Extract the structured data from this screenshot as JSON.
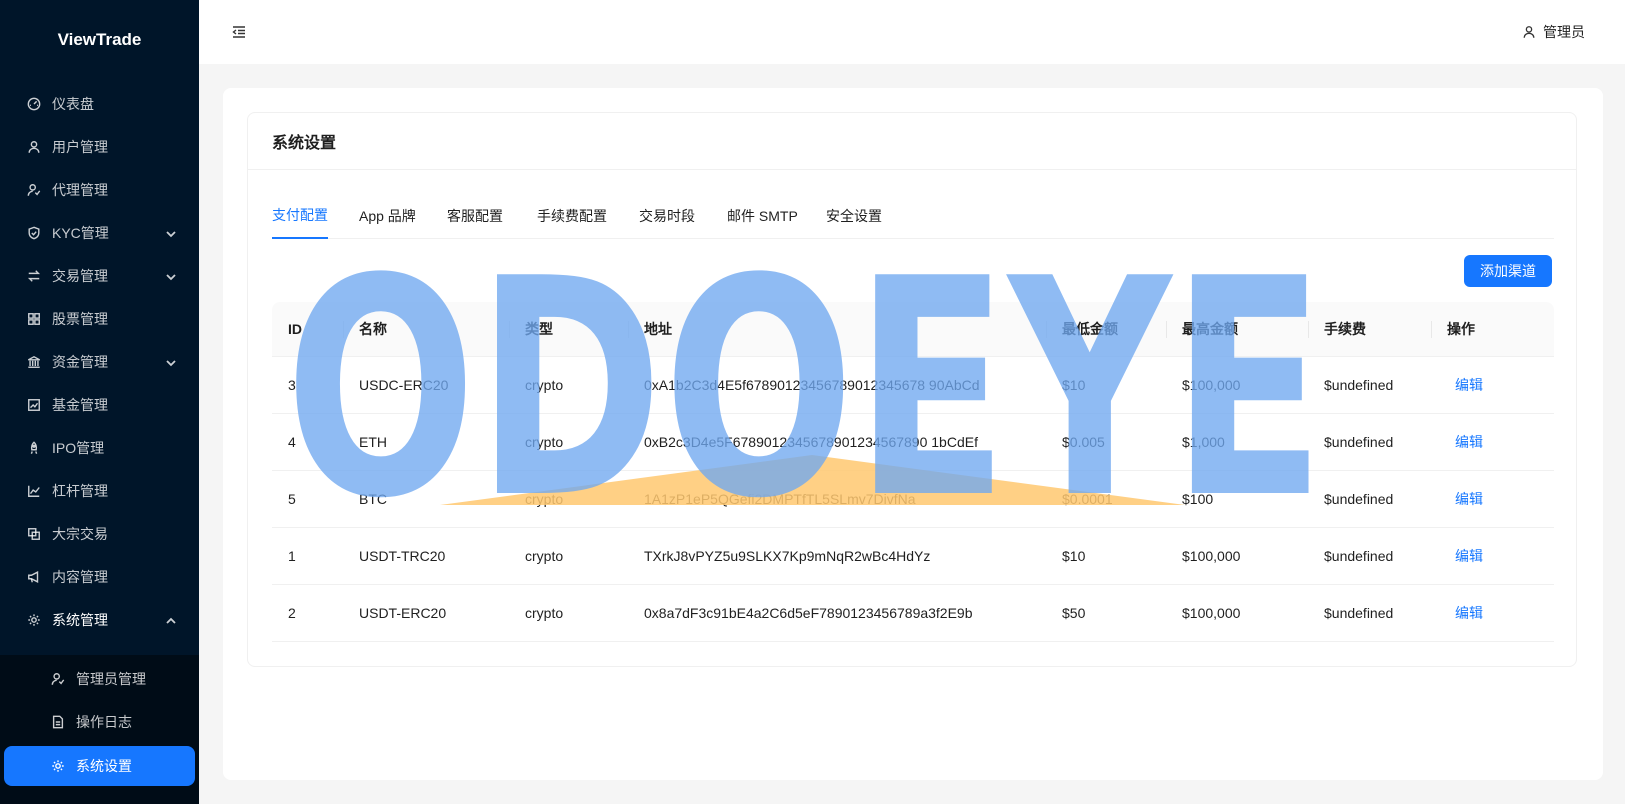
{
  "brand": "ViewTrade",
  "sidebar": {
    "items": [
      {
        "label": "仪表盘",
        "icon": "dashboard-icon"
      },
      {
        "label": "用户管理",
        "icon": "user-icon"
      },
      {
        "label": "代理管理",
        "icon": "agent-icon"
      },
      {
        "label": "KYC管理",
        "icon": "shield-icon"
      },
      {
        "label": "交易管理",
        "icon": "swap-icon"
      },
      {
        "label": "股票管理",
        "icon": "grid-icon"
      },
      {
        "label": "资金管理",
        "icon": "bank-icon"
      },
      {
        "label": "基金管理",
        "icon": "stock-chart-icon"
      },
      {
        "label": "IPO管理",
        "icon": "rocket-icon"
      },
      {
        "label": "杠杆管理",
        "icon": "line-chart-icon"
      },
      {
        "label": "大宗交易",
        "icon": "block-icon"
      },
      {
        "label": "内容管理",
        "icon": "megaphone-icon"
      },
      {
        "label": "系统管理",
        "icon": "setting-icon"
      }
    ],
    "sub_items": [
      {
        "label": "管理员管理",
        "icon": "admin-icon"
      },
      {
        "label": "操作日志",
        "icon": "file-icon"
      },
      {
        "label": "系统设置",
        "icon": "setting-icon"
      }
    ]
  },
  "header": {
    "user_label": "管理员"
  },
  "card": {
    "title": "系统设置"
  },
  "tabs": [
    "支付配置",
    "App 品牌",
    "客服配置",
    "手续费配置",
    "交易时段",
    "邮件 SMTP",
    "安全设置"
  ],
  "add_button": "添加渠道",
  "table": {
    "headers": [
      "ID",
      "名称",
      "类型",
      "地址",
      "最低金额",
      "最高金额",
      "手续费",
      "操作"
    ],
    "rows": [
      [
        "3",
        "USDC-ERC20",
        "crypto",
        "0xA1b2C3d4E5f67890123456789012345678 90AbCd",
        "$10",
        "$100,000",
        "$undefined",
        "编辑"
      ],
      [
        "4",
        "ETH",
        "crypto",
        "0xB2c3D4e5F6789012345678901234567890 1bCdEf",
        "$0.005",
        "$1,000",
        "$undefined",
        "编辑"
      ],
      [
        "5",
        "BTC",
        "crypto",
        "1A1zP1eP5QGefi2DMPTfTL5SLmv7DivfNa",
        "$0.0001",
        "$100",
        "$undefined",
        "编辑"
      ],
      [
        "1",
        "USDT-TRC20",
        "crypto",
        "TXrkJ8vPYZ5u9SLKX7Kp9mNqR2wBc4HdYz",
        "$10",
        "$100,000",
        "$undefined",
        "编辑"
      ],
      [
        "2",
        "USDT-ERC20",
        "crypto",
        "0x8a7dF3c91bE4a2C6d5eF7890123456789a3f2E9b",
        "$50",
        "$100,000",
        "$undefined",
        "编辑"
      ]
    ]
  },
  "watermark": "ODOEYE",
  "colors": {
    "sidebar_bg": "#001529",
    "accent": "#1677ff",
    "watermark_blue": "#6fa8f0",
    "watermark_orange": "#ffc870"
  }
}
